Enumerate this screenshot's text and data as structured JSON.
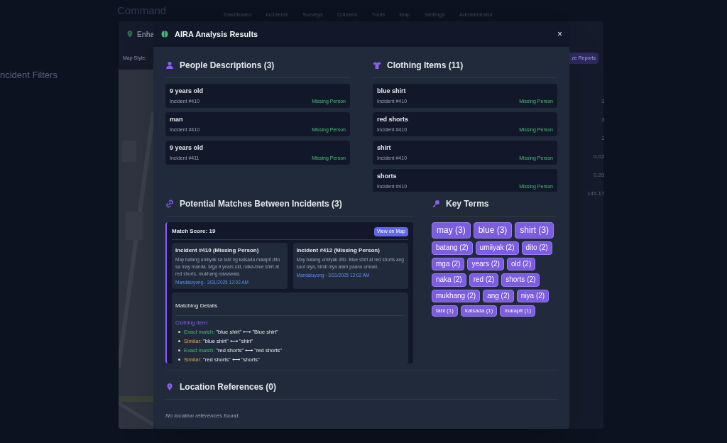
{
  "background": {
    "app_title": "Command",
    "nav": [
      "Dashboard",
      "Incidents",
      "Surveys",
      "Citizens",
      "Tools",
      "Map",
      "Settings",
      "Administrator"
    ],
    "sidebar_title": "ncident Filters",
    "panel_title": "Enha",
    "map_style_label": "Map Style:",
    "analyze_button": "ze Reports",
    "stats": [
      "3",
      "3",
      "1",
      "0.02",
      "0.20",
      "145.17"
    ]
  },
  "modal": {
    "title": "AIRA Analysis Results",
    "close": "×",
    "people": {
      "title": "People Descriptions (3)",
      "items": [
        {
          "text": "9 years old",
          "incident": "Incident #410",
          "category": "Missing Person"
        },
        {
          "text": "man",
          "incident": "Incident #410",
          "category": "Missing Person"
        },
        {
          "text": "9 years old",
          "incident": "Incident #411",
          "category": "Missing Person"
        }
      ]
    },
    "clothing": {
      "title": "Clothing Items (11)",
      "items": [
        {
          "text": "blue shirt",
          "incident": "Incident #410",
          "category": "Missing Person"
        },
        {
          "text": "red shorts",
          "incident": "Incident #410",
          "category": "Missing Person"
        },
        {
          "text": "shirt",
          "incident": "Incident #410",
          "category": "Missing Person"
        },
        {
          "text": "shorts",
          "incident": "Incident #410",
          "category": "Missing Person"
        }
      ]
    },
    "matches": {
      "title": "Potential Matches Between Incidents (3)",
      "items": [
        {
          "score": "Match Score: 19",
          "button": "View on Map",
          "incidents": [
            {
              "title": "Incident #410 (Missing Person)",
              "description": "May batang umiiyak sa tabi ng kalsada malapit dito sa may manda. Mga 9 years old, naka-blue shirt at red shorts, mukhang nawawala.",
              "meta": "Mandaluyong - 3/31/2025 12:02 AM"
            },
            {
              "title": "Incident #412 (Missing Person)",
              "description": "May batang umiiyak dito. Blue shirt at red shorts ang suot niya, hindi niya alam paano umuwi.",
              "meta": "Mandaluyong - 3/31/2025 12:02 AM"
            }
          ],
          "details_title": "Matching Details",
          "category": "Clothing Item:",
          "details": [
            {
              "kind": "exact",
              "label": "Exact match:",
              "text": "\"blue shirt\" ⟷ \"Blue shirt\""
            },
            {
              "kind": "similar",
              "label": "Similar:",
              "text": "\"blue shirt\" ⟷ \"shirt\""
            },
            {
              "kind": "exact",
              "label": "Exact match:",
              "text": "\"red shorts\" ⟷ \"red shorts\""
            },
            {
              "kind": "similar",
              "label": "Similar:",
              "text": "\"red shorts\" ⟷ \"shorts\""
            }
          ]
        }
      ]
    },
    "key_terms": {
      "title": "Key Terms",
      "terms": [
        {
          "text": "may (3)",
          "kind": "large"
        },
        {
          "text": "blue (3)",
          "kind": "large"
        },
        {
          "text": "shirt (3)",
          "kind": "large"
        },
        {
          "text": "batang (2)",
          "kind": "medium"
        },
        {
          "text": "umiiyak (2)",
          "kind": "medium"
        },
        {
          "text": "dito (2)",
          "kind": "medium"
        },
        {
          "text": "mga (2)",
          "kind": "medium"
        },
        {
          "text": "years (2)",
          "kind": "medium"
        },
        {
          "text": "old (2)",
          "kind": "medium"
        },
        {
          "text": "naka (2)",
          "kind": "medium"
        },
        {
          "text": "red (2)",
          "kind": "medium"
        },
        {
          "text": "shorts (2)",
          "kind": "medium"
        },
        {
          "text": "mukhang (2)",
          "kind": "medium"
        },
        {
          "text": "ang (2)",
          "kind": "medium"
        },
        {
          "text": "niya (2)",
          "kind": "medium"
        },
        {
          "text": "tabi (1)",
          "kind": "small"
        },
        {
          "text": "kalsada (1)",
          "kind": "small"
        },
        {
          "text": "malapit (1)",
          "kind": "small"
        }
      ]
    },
    "locations": {
      "title": "Location References (0)",
      "empty": "No location references found."
    }
  }
}
